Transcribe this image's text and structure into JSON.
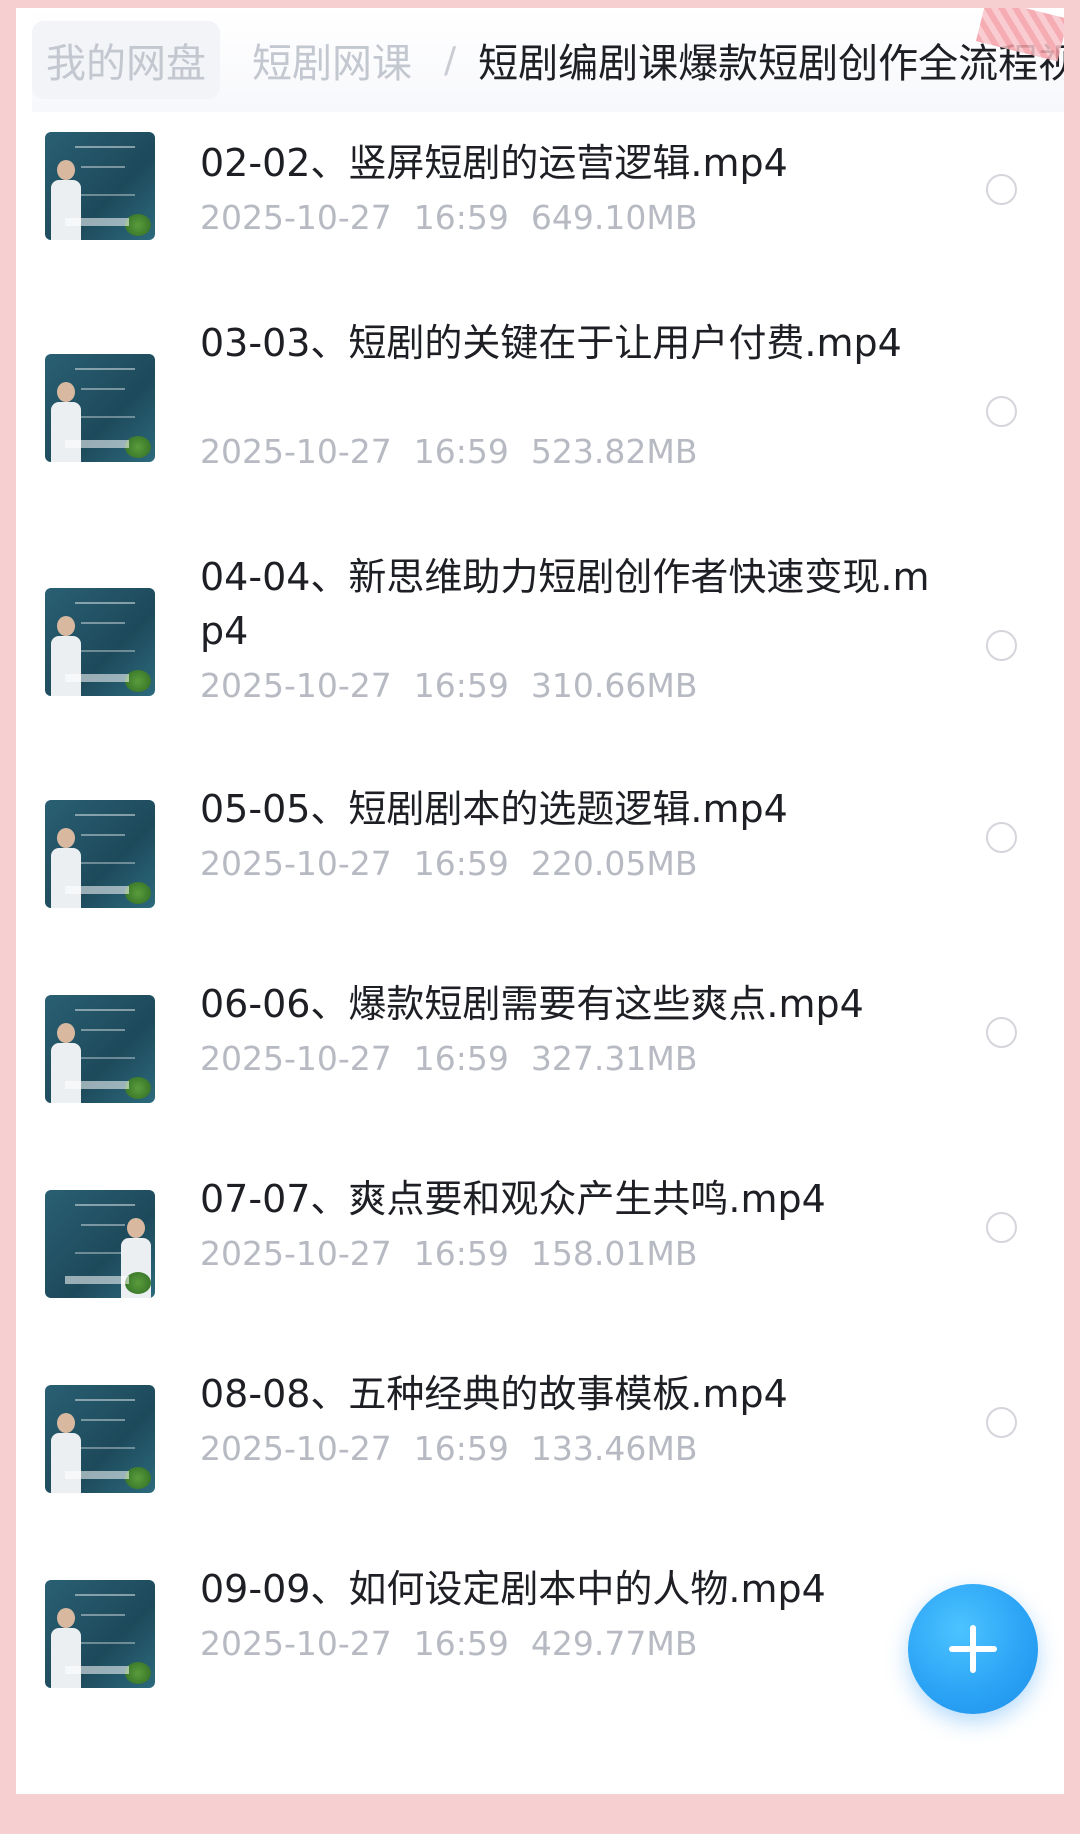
{
  "breadcrumb": {
    "items": [
      "我的网盘",
      "短剧网课"
    ],
    "separator": "/",
    "current": "短剧编剧课爆款短剧创作全流程视"
  },
  "files": [
    {
      "name": "02-02、竖屏短剧的运营逻辑.mp4",
      "date": "2025-10-27",
      "time": "16:59",
      "size": "649.10MB"
    },
    {
      "name": "03-03、短剧的关键在于让用户付费.mp4",
      "date": "2025-10-27",
      "time": "16:59",
      "size": "523.82MB"
    },
    {
      "name": "04-04、新思维助力短剧创作者快速变现.mp4",
      "date": "2025-10-27",
      "time": "16:59",
      "size": "310.66MB"
    },
    {
      "name": "05-05、短剧剧本的选题逻辑.mp4",
      "date": "2025-10-27",
      "time": "16:59",
      "size": "220.05MB"
    },
    {
      "name": "06-06、爆款短剧需要有这些爽点.mp4",
      "date": "2025-10-27",
      "time": "16:59",
      "size": "327.31MB"
    },
    {
      "name": "07-07、爽点要和观众产生共鸣.mp4",
      "date": "2025-10-27",
      "time": "16:59",
      "size": "158.01MB"
    },
    {
      "name": "08-08、五种经典的故事模板.mp4",
      "date": "2025-10-27",
      "time": "16:59",
      "size": "133.46MB"
    },
    {
      "name": "09-09、如何设定剧本中的人物.mp4",
      "date": "2025-10-27",
      "time": "16:59",
      "size": "429.77MB"
    }
  ],
  "fab": {
    "icon": "plus-icon",
    "color": "#2aa2f5"
  },
  "colors": {
    "background": "#f6cfd1",
    "title": "#1d1f24",
    "meta": "#b7bac2"
  }
}
